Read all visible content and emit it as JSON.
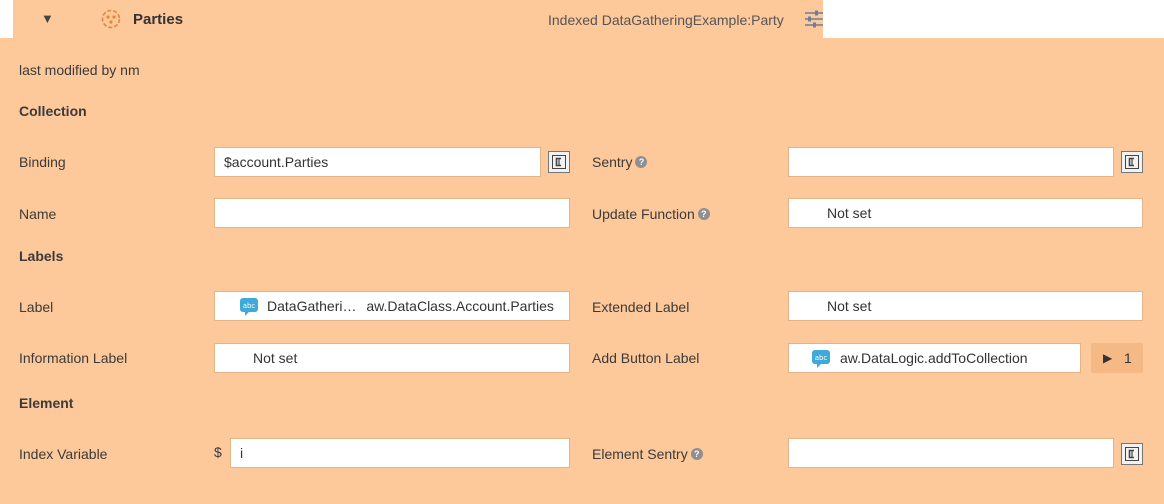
{
  "header": {
    "toggle": "▼",
    "title": "Parties",
    "subtitle": "Indexed DataGatheringExample:Party"
  },
  "meta": {
    "last_modified": "last modified by nm"
  },
  "sections": {
    "collection": "Collection",
    "labels": "Labels",
    "element": "Element"
  },
  "fields": {
    "binding": {
      "label": "Binding",
      "value": "$account.Parties"
    },
    "sentry": {
      "label": "Sentry",
      "value": ""
    },
    "name": {
      "label": "Name",
      "value": ""
    },
    "update_function": {
      "label": "Update Function",
      "value": "Not set"
    },
    "label": {
      "label": "Label",
      "value_left": "DataGatheri…",
      "value_right": "aw.DataClass.Account.Parties"
    },
    "extended_label": {
      "label": "Extended Label",
      "value": "Not set"
    },
    "information_label": {
      "label": "Information Label",
      "value": "Not set"
    },
    "add_button_label": {
      "label": "Add Button Label",
      "value": "aw.DataLogic.addToCollection",
      "count": "1"
    },
    "index_variable": {
      "label": "Index Variable",
      "prefix": "$",
      "value": "i"
    },
    "element_sentry": {
      "label": "Element Sentry",
      "value": ""
    }
  },
  "icons": {
    "help": "?",
    "play": "▶"
  },
  "colors": {
    "panel_bg": "#fdc89a",
    "icon_orange": "#e8843a",
    "abc_blue": "#3fa9d8"
  }
}
